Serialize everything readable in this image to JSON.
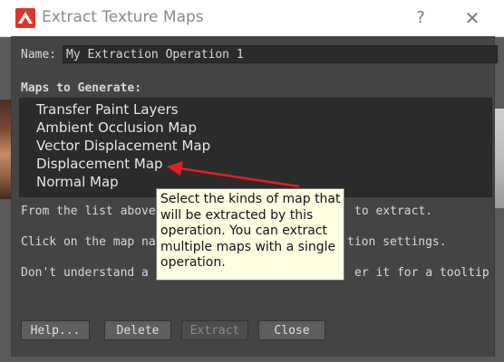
{
  "window": {
    "title": "Extract Texture Maps",
    "help_glyph": "?",
    "close_glyph": "✕",
    "icon": "autodesk-maya-logo"
  },
  "name_field": {
    "label": "Name:",
    "value": "My Extraction Operation 1"
  },
  "maps_section": {
    "title": "Maps to Generate:",
    "items": [
      "Transfer Paint Layers",
      "Ambient Occlusion Map",
      "Vector Displacement Map",
      "Displacement Map",
      "Normal Map"
    ]
  },
  "info": {
    "line1_a": "From the list above",
    "line1_b": "to extract.",
    "line2_a": "Click on the map na",
    "line2_b": "tion settings.",
    "line3_a": "Don't understand a",
    "line3_b": "er it for a tooltip"
  },
  "buttons": {
    "help": "Help...",
    "delete": "Delete",
    "extract": "Extract",
    "close": "Close"
  },
  "tooltip": {
    "lines": [
      "Select the kinds of map that",
      "will be extracted by this",
      "operation. You can extract",
      "multiple maps with a single",
      "operation."
    ]
  },
  "colors": {
    "dialog_bg": "#444444",
    "list_bg": "#2b2b2b",
    "tooltip_bg": "#ffffe1",
    "arrow": "#e02020",
    "logo_red": "#d9372b"
  }
}
